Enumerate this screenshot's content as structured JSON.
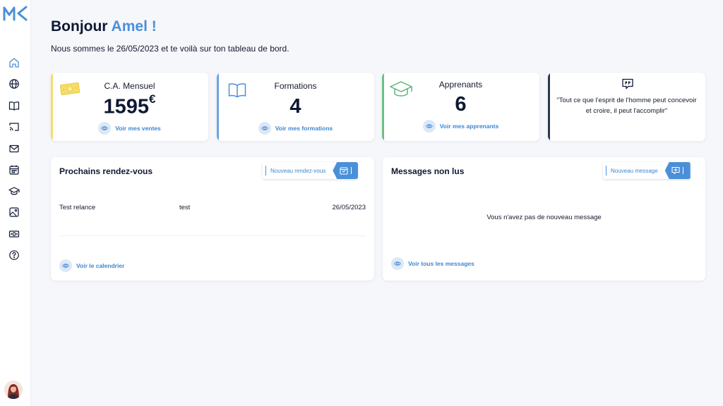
{
  "app": {
    "logo_text": "MK"
  },
  "sidebar": {
    "items": [
      {
        "icon": "home-icon"
      },
      {
        "icon": "globe-icon"
      },
      {
        "icon": "book-icon"
      },
      {
        "icon": "cast-icon"
      },
      {
        "icon": "mail-icon"
      },
      {
        "icon": "calendar-icon"
      },
      {
        "icon": "graduation-cap-icon"
      },
      {
        "icon": "image-icon"
      },
      {
        "icon": "money-icon"
      },
      {
        "icon": "help-icon"
      }
    ],
    "avatar_icon": "user-avatar"
  },
  "header": {
    "greeting": "Bonjour",
    "name": "Amel !",
    "subtitle": "Nous sommes le 26/05/2023 et te voilà sur ton tableau de bord."
  },
  "stats": [
    {
      "title": "C.A. Mensuel",
      "value": "1595",
      "unit": "€",
      "link": "Voir mes ventes",
      "icon": "money-bill-icon",
      "accent": "#f5dd6a"
    },
    {
      "title": "Formations",
      "value": "4",
      "link": "Voir mes formations",
      "icon": "book-open-icon",
      "accent": "#6aa6e0"
    },
    {
      "title": "Apprenants",
      "value": "6",
      "link": "Voir mes apprenants",
      "icon": "graduation-cap-icon",
      "accent": "#6dbf85"
    }
  ],
  "quote": {
    "icon": "quote-bubble-icon",
    "text": "\"Tout ce que l'esprit de l'homme peut concevoir et croire, il peut l'accomplir\"",
    "accent": "#2c3a4f"
  },
  "appointments": {
    "title": "Prochains rendez-vous",
    "action_label": "Nouveau rendez-vous",
    "rows": [
      {
        "name": "Test relance",
        "note": "test",
        "date": "26/05/2023"
      }
    ],
    "link": "Voir le calendrier"
  },
  "messages": {
    "title": "Messages non lus",
    "action_label": "Nouveau message",
    "empty_text": "Vous n'avez pas de nouveau message",
    "link": "Voir tous les messages"
  },
  "colors": {
    "primary": "#4a90d9",
    "link": "#3f86d0",
    "text": "#0f1833",
    "background": "#f6f7fb"
  }
}
